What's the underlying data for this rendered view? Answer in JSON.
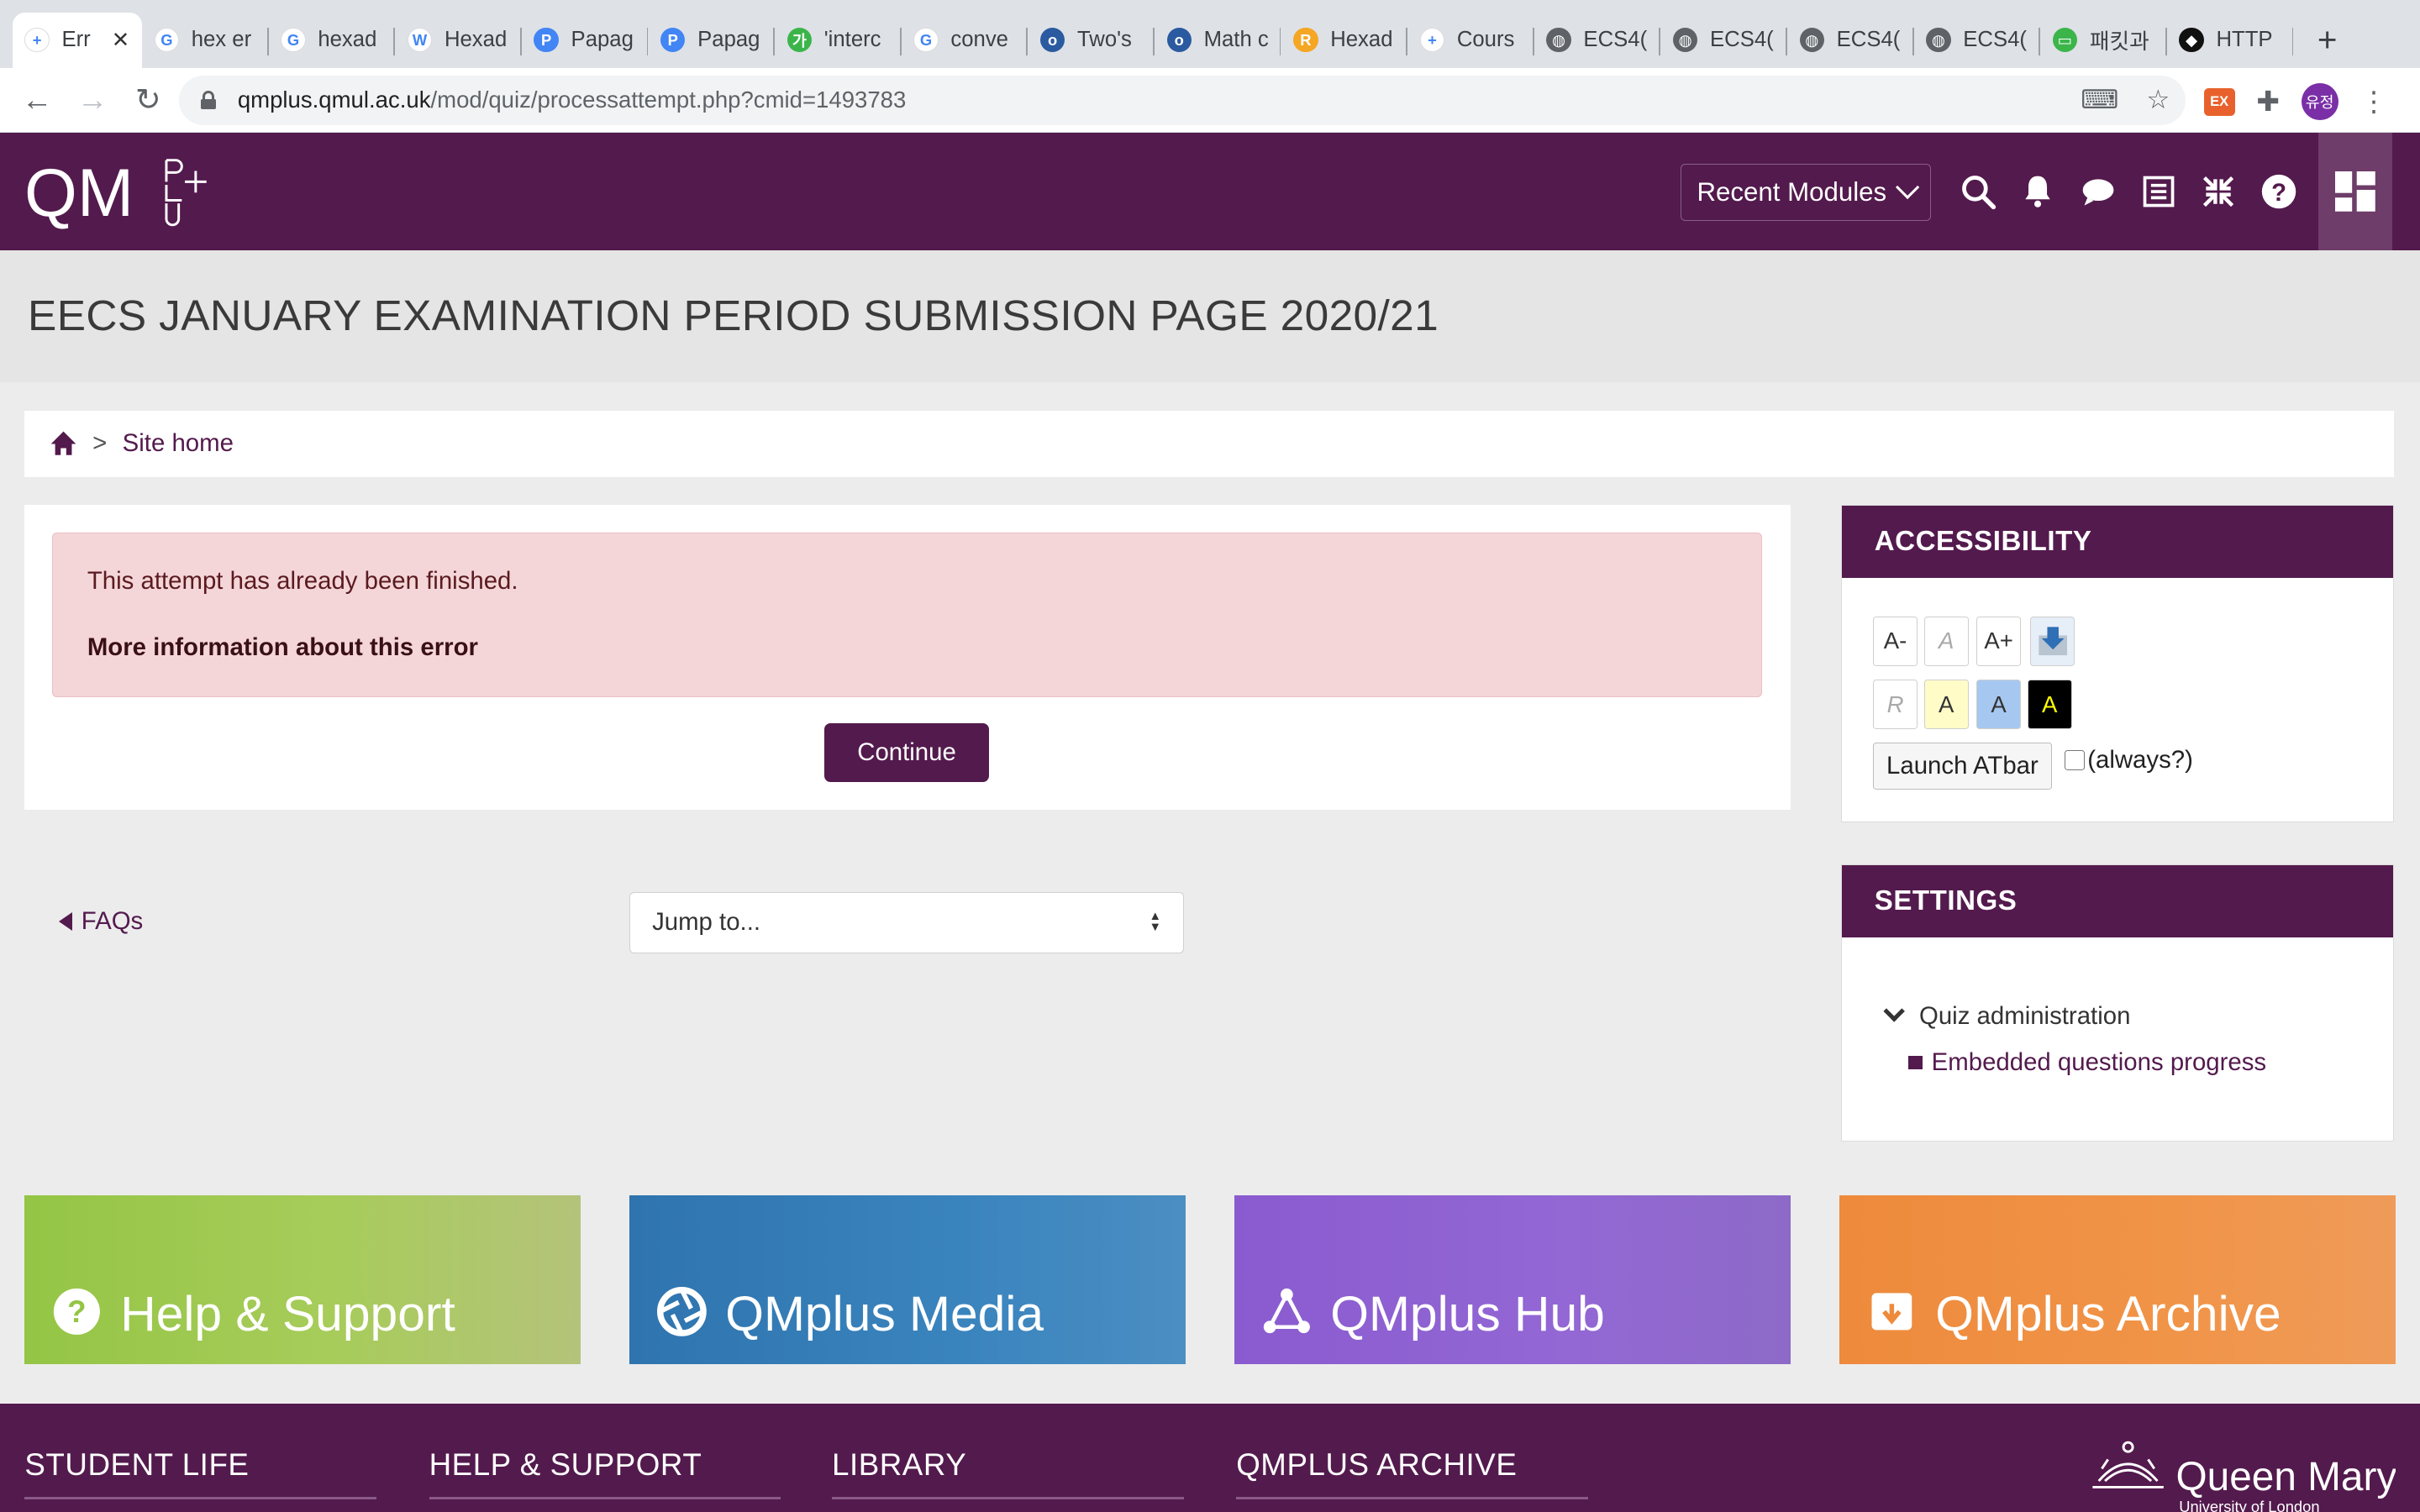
{
  "browser": {
    "tabs": [
      {
        "label": "Err",
        "color": "#ffffff",
        "glyph": "+",
        "active": true
      },
      {
        "label": "hex er",
        "color": "#ffffff",
        "glyph": "G"
      },
      {
        "label": "hexad",
        "color": "#ffffff",
        "glyph": "G"
      },
      {
        "label": "Hexad",
        "color": "#ffffff",
        "glyph": "W"
      },
      {
        "label": "Papag",
        "color": "#4285f4",
        "glyph": "P"
      },
      {
        "label": "Papag",
        "color": "#4285f4",
        "glyph": "P"
      },
      {
        "label": "'interc",
        "color": "#3bb54a",
        "glyph": "가"
      },
      {
        "label": "conve",
        "color": "#ffffff",
        "glyph": "G"
      },
      {
        "label": "Two's",
        "color": "#2a5aa0",
        "glyph": "o"
      },
      {
        "label": "Math c",
        "color": "#2a5aa0",
        "glyph": "o"
      },
      {
        "label": "Hexad",
        "color": "#f5a623",
        "glyph": "R"
      },
      {
        "label": "Cours",
        "color": "#ffffff",
        "glyph": "+"
      },
      {
        "label": "ECS4(",
        "color": "#5f6368",
        "glyph": "◍"
      },
      {
        "label": "ECS4(",
        "color": "#5f6368",
        "glyph": "◍"
      },
      {
        "label": "ECS4(",
        "color": "#5f6368",
        "glyph": "◍"
      },
      {
        "label": "ECS4(",
        "color": "#5f6368",
        "glyph": "◍"
      },
      {
        "label": "패킷과",
        "color": "#3bb54a",
        "glyph": "▭"
      },
      {
        "label": "HTTP",
        "color": "#111111",
        "glyph": "◆"
      }
    ],
    "new_tab": "+",
    "url_host": "qmplus.qmul.ac.uk",
    "url_path": "/mod/quiz/processattempt.php?cmid=1493783",
    "ext_label": "EX",
    "avatar_text": "유정"
  },
  "navbar": {
    "logo_text": "QM",
    "logo_sub": "PLUS",
    "recent_modules": "Recent Modules",
    "icons": [
      "search-icon",
      "bell-icon",
      "chat-icon",
      "list-icon",
      "collapse-icon",
      "help-icon"
    ],
    "brand_color": "#531a4d"
  },
  "page": {
    "title": "EECS JANUARY EXAMINATION PERIOD SUBMISSION PAGE 2020/21"
  },
  "breadcrumb": {
    "separator": ">",
    "site_home": "Site home"
  },
  "alert": {
    "message": "This attempt has already been finished.",
    "more_info": "More information about this error",
    "continue": "Continue"
  },
  "nav": {
    "faqs": "FAQs",
    "jump_placeholder": "Jump to..."
  },
  "accessibility": {
    "heading": "ACCESSIBILITY",
    "decrease": "A-",
    "reset": "A",
    "increase": "A+",
    "scheme_reset": "R",
    "scheme_yellow": "A",
    "scheme_blue": "A",
    "scheme_black": "A",
    "launch": "Launch ATbar",
    "always": "(always?)"
  },
  "settings": {
    "heading": "SETTINGS",
    "quiz_admin": "Quiz administration",
    "embedded": "Embedded questions progress"
  },
  "tiles": {
    "help": "Help & Support",
    "media": "QMplus Media",
    "hub": "QMplus Hub",
    "archive": "QMplus Archive"
  },
  "footer": {
    "student_life": "STUDENT LIFE",
    "help_support": "HELP & SUPPORT",
    "library": "LIBRARY",
    "archive": "QMPLUS ARCHIVE",
    "qm_brand": "Queen Mary",
    "qm_sub": "University of London"
  }
}
